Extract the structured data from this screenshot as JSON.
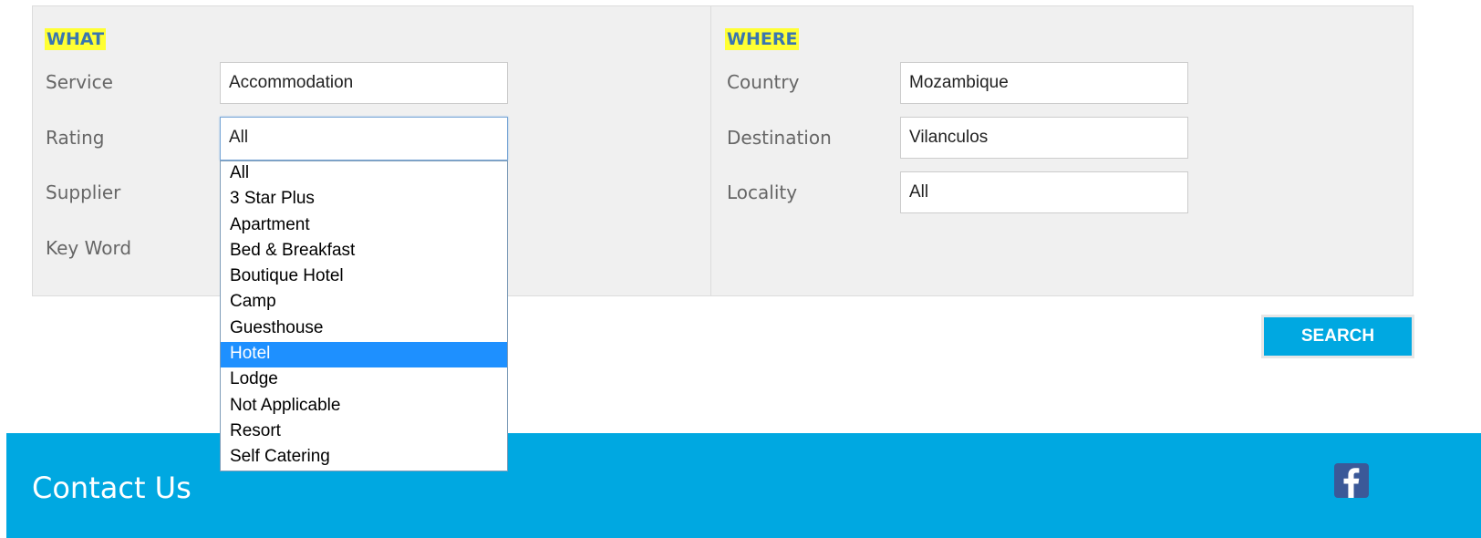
{
  "what": {
    "heading": "WHAT",
    "service_label": "Service",
    "service_value": "Accommodation",
    "rating_label": "Rating",
    "rating_value": "All",
    "supplier_label": "Supplier",
    "keyword_label": "Key Word",
    "rating_options": [
      "All",
      "3 Star Plus",
      "Apartment",
      "Bed & Breakfast",
      "Boutique Hotel",
      "Camp",
      "Guesthouse",
      "Hotel",
      "Lodge",
      "Not Applicable",
      "Resort",
      "Self Catering"
    ],
    "highlighted_option": "Hotel"
  },
  "where": {
    "heading": "WHERE",
    "country_label": "Country",
    "country_value": "Mozambique",
    "destination_label": "Destination",
    "destination_value": "Vilanculos",
    "locality_label": "Locality",
    "locality_value": "All"
  },
  "search_button_label": "SEARCH",
  "footer": {
    "title": "Contact Us",
    "social_icon": "facebook-icon"
  },
  "colors": {
    "accent": "#00a8e1",
    "highlight": "#ffff33",
    "heading_text": "#3a76b0",
    "selected_option": "#1e90ff",
    "facebook": "#3b5998"
  }
}
